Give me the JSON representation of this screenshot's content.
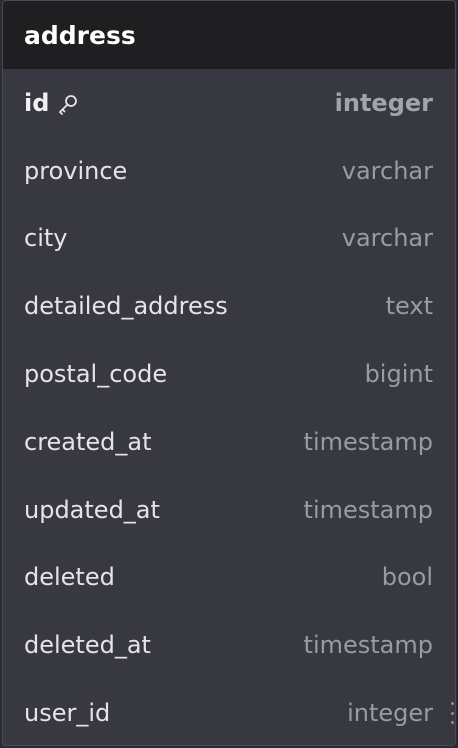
{
  "table": {
    "name": "address",
    "columns": [
      {
        "name": "id",
        "type": "integer",
        "primary_key": true,
        "icon": "key-icon"
      },
      {
        "name": "province",
        "type": "varchar"
      },
      {
        "name": "city",
        "type": "varchar"
      },
      {
        "name": "detailed_address",
        "type": "text"
      },
      {
        "name": "postal_code",
        "type": "bigint"
      },
      {
        "name": "created_at",
        "type": "timestamp"
      },
      {
        "name": "updated_at",
        "type": "timestamp"
      },
      {
        "name": "deleted",
        "type": "bool"
      },
      {
        "name": "deleted_at",
        "type": "timestamp"
      },
      {
        "name": "user_id",
        "type": "integer",
        "has_relation_handle": true
      }
    ]
  },
  "colors": {
    "header_bg": "#1f1f21",
    "body_bg": "#383940",
    "name_text": "#e4e4e8",
    "type_text": "#9a9ba2"
  }
}
